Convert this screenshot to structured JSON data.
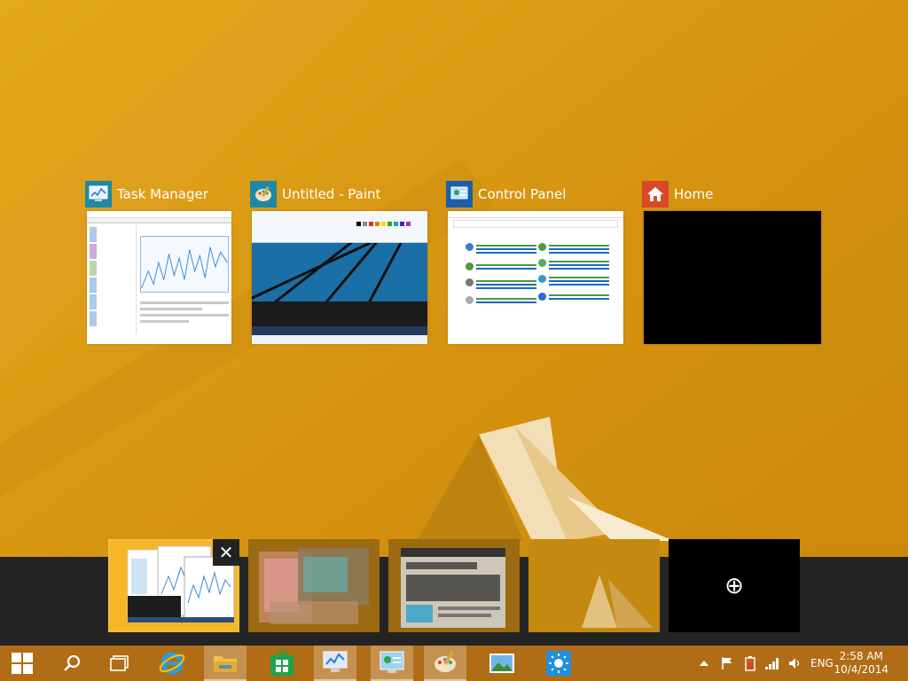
{
  "windows": [
    {
      "title": "Task Manager",
      "icon": "task-manager-icon"
    },
    {
      "title": "Untitled - Paint",
      "icon": "paint-icon"
    },
    {
      "title": "Control Panel",
      "icon": "control-panel-icon"
    },
    {
      "title": "Home",
      "icon": "home-icon"
    }
  ],
  "desktops": {
    "close_label": "✕",
    "add_label": "⊕"
  },
  "taskbar": {
    "apps": [
      "start-icon",
      "search-icon",
      "task-view-icon",
      "internet-explorer-icon",
      "file-explorer-icon",
      "store-icon",
      "task-manager-icon",
      "control-panel-icon",
      "paint-icon",
      "photos-icon",
      "weather-icon"
    ],
    "tray": {
      "language": "ENG",
      "time": "2:58 AM",
      "date": "10/4/2014"
    }
  },
  "colors": {
    "wallpaper": "#d89a12",
    "taskbar": "#b16c16",
    "desktop_bar": "#242424"
  }
}
